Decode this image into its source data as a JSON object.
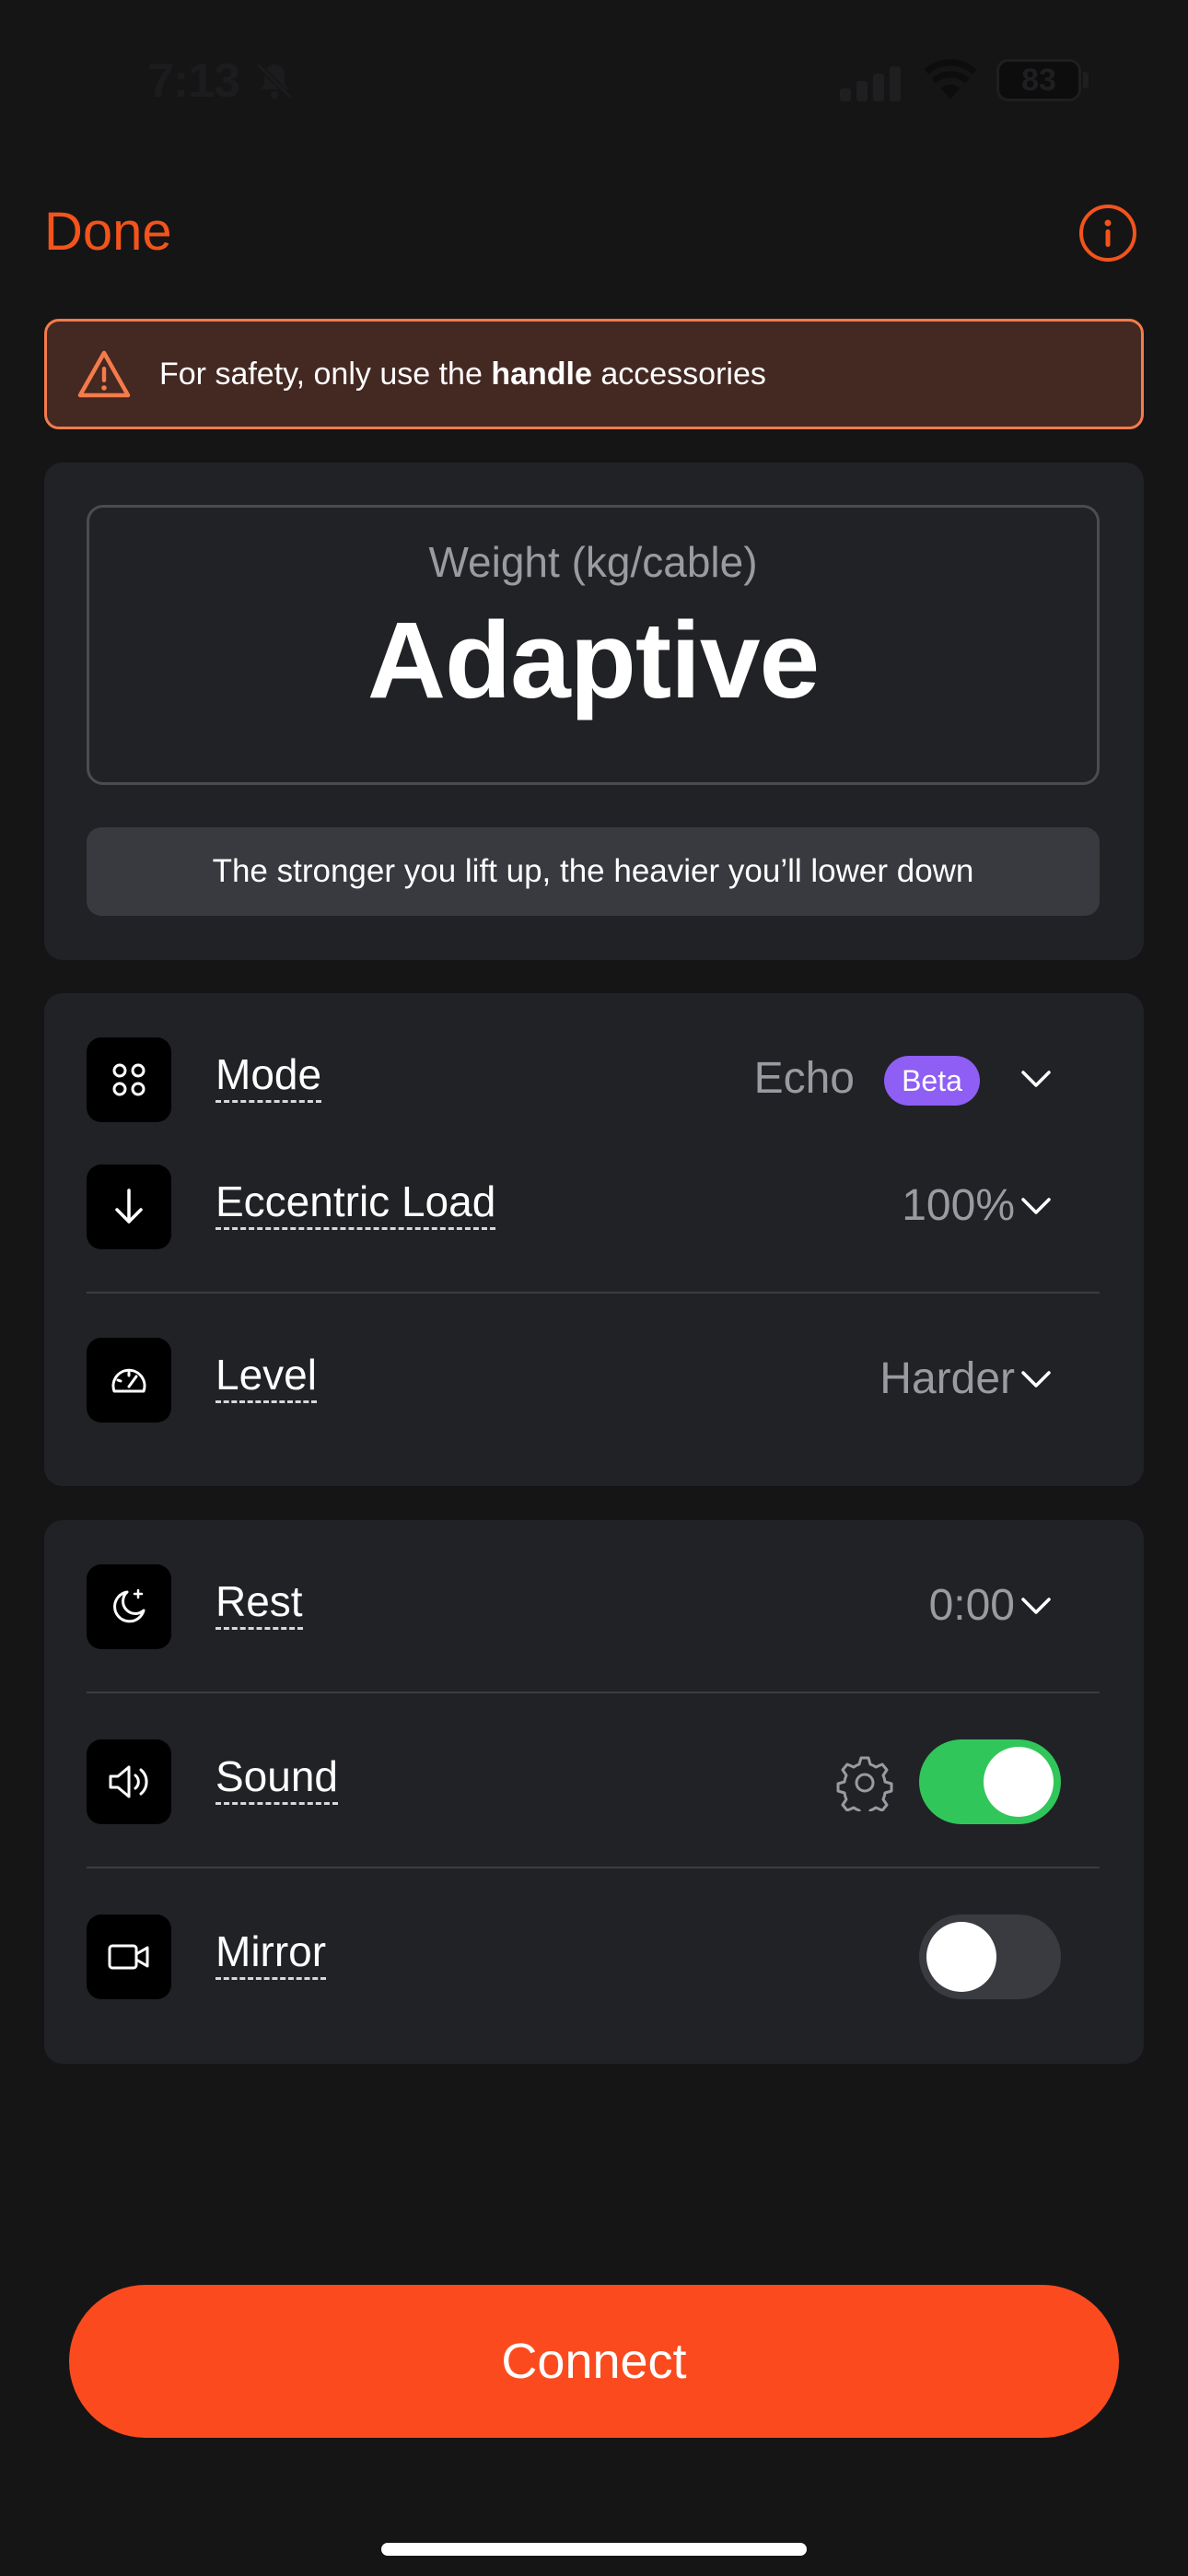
{
  "status_bar": {
    "time": "7:13",
    "battery": "83"
  },
  "nav": {
    "done_label": "Done"
  },
  "warning": {
    "prefix": "For safety, only use the ",
    "bold": "handle",
    "suffix": " accessories"
  },
  "weight": {
    "label": "Weight (kg/cable)",
    "value": "Adaptive",
    "hint": "The stronger you lift up, the heavier you’ll lower down"
  },
  "settings": {
    "mode": {
      "label": "Mode",
      "value": "Echo",
      "badge": "Beta"
    },
    "eccentric": {
      "label": "Eccentric Load",
      "value": "100%"
    },
    "level": {
      "label": "Level",
      "value": "Harder"
    }
  },
  "options": {
    "rest": {
      "label": "Rest",
      "value": "0:00"
    },
    "sound": {
      "label": "Sound",
      "enabled": true
    },
    "mirror": {
      "label": "Mirror",
      "enabled": false
    }
  },
  "connect_label": "Connect",
  "colors": {
    "accent": "#f2541b",
    "connect": "#fb4b1e",
    "toggle_on": "#31c65a",
    "beta": "#8e5ef5",
    "warning_bg": "#442822"
  }
}
